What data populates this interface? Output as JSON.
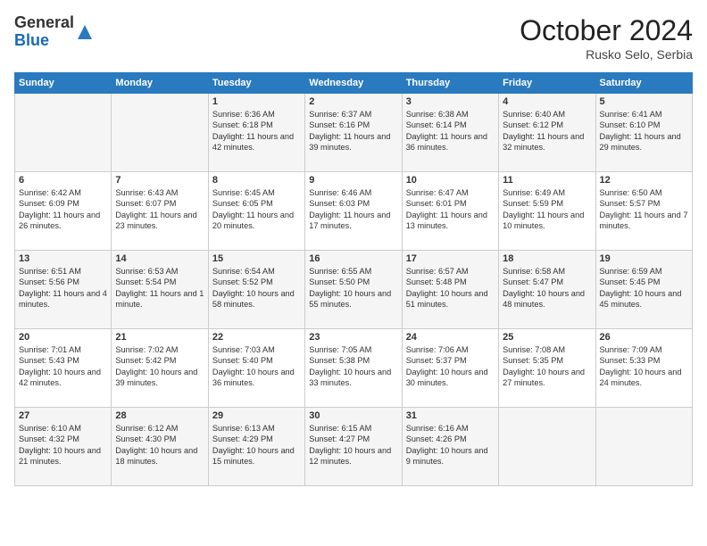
{
  "logo": {
    "general": "General",
    "blue": "Blue"
  },
  "header": {
    "month": "October 2024",
    "location": "Rusko Selo, Serbia"
  },
  "weekdays": [
    "Sunday",
    "Monday",
    "Tuesday",
    "Wednesday",
    "Thursday",
    "Friday",
    "Saturday"
  ],
  "weeks": [
    [
      {
        "day": "",
        "content": ""
      },
      {
        "day": "",
        "content": ""
      },
      {
        "day": "1",
        "content": "Sunrise: 6:36 AM\nSunset: 6:18 PM\nDaylight: 11 hours and 42 minutes."
      },
      {
        "day": "2",
        "content": "Sunrise: 6:37 AM\nSunset: 6:16 PM\nDaylight: 11 hours and 39 minutes."
      },
      {
        "day": "3",
        "content": "Sunrise: 6:38 AM\nSunset: 6:14 PM\nDaylight: 11 hours and 36 minutes."
      },
      {
        "day": "4",
        "content": "Sunrise: 6:40 AM\nSunset: 6:12 PM\nDaylight: 11 hours and 32 minutes."
      },
      {
        "day": "5",
        "content": "Sunrise: 6:41 AM\nSunset: 6:10 PM\nDaylight: 11 hours and 29 minutes."
      }
    ],
    [
      {
        "day": "6",
        "content": "Sunrise: 6:42 AM\nSunset: 6:09 PM\nDaylight: 11 hours and 26 minutes."
      },
      {
        "day": "7",
        "content": "Sunrise: 6:43 AM\nSunset: 6:07 PM\nDaylight: 11 hours and 23 minutes."
      },
      {
        "day": "8",
        "content": "Sunrise: 6:45 AM\nSunset: 6:05 PM\nDaylight: 11 hours and 20 minutes."
      },
      {
        "day": "9",
        "content": "Sunrise: 6:46 AM\nSunset: 6:03 PM\nDaylight: 11 hours and 17 minutes."
      },
      {
        "day": "10",
        "content": "Sunrise: 6:47 AM\nSunset: 6:01 PM\nDaylight: 11 hours and 13 minutes."
      },
      {
        "day": "11",
        "content": "Sunrise: 6:49 AM\nSunset: 5:59 PM\nDaylight: 11 hours and 10 minutes."
      },
      {
        "day": "12",
        "content": "Sunrise: 6:50 AM\nSunset: 5:57 PM\nDaylight: 11 hours and 7 minutes."
      }
    ],
    [
      {
        "day": "13",
        "content": "Sunrise: 6:51 AM\nSunset: 5:56 PM\nDaylight: 11 hours and 4 minutes."
      },
      {
        "day": "14",
        "content": "Sunrise: 6:53 AM\nSunset: 5:54 PM\nDaylight: 11 hours and 1 minute."
      },
      {
        "day": "15",
        "content": "Sunrise: 6:54 AM\nSunset: 5:52 PM\nDaylight: 10 hours and 58 minutes."
      },
      {
        "day": "16",
        "content": "Sunrise: 6:55 AM\nSunset: 5:50 PM\nDaylight: 10 hours and 55 minutes."
      },
      {
        "day": "17",
        "content": "Sunrise: 6:57 AM\nSunset: 5:48 PM\nDaylight: 10 hours and 51 minutes."
      },
      {
        "day": "18",
        "content": "Sunrise: 6:58 AM\nSunset: 5:47 PM\nDaylight: 10 hours and 48 minutes."
      },
      {
        "day": "19",
        "content": "Sunrise: 6:59 AM\nSunset: 5:45 PM\nDaylight: 10 hours and 45 minutes."
      }
    ],
    [
      {
        "day": "20",
        "content": "Sunrise: 7:01 AM\nSunset: 5:43 PM\nDaylight: 10 hours and 42 minutes."
      },
      {
        "day": "21",
        "content": "Sunrise: 7:02 AM\nSunset: 5:42 PM\nDaylight: 10 hours and 39 minutes."
      },
      {
        "day": "22",
        "content": "Sunrise: 7:03 AM\nSunset: 5:40 PM\nDaylight: 10 hours and 36 minutes."
      },
      {
        "day": "23",
        "content": "Sunrise: 7:05 AM\nSunset: 5:38 PM\nDaylight: 10 hours and 33 minutes."
      },
      {
        "day": "24",
        "content": "Sunrise: 7:06 AM\nSunset: 5:37 PM\nDaylight: 10 hours and 30 minutes."
      },
      {
        "day": "25",
        "content": "Sunrise: 7:08 AM\nSunset: 5:35 PM\nDaylight: 10 hours and 27 minutes."
      },
      {
        "day": "26",
        "content": "Sunrise: 7:09 AM\nSunset: 5:33 PM\nDaylight: 10 hours and 24 minutes."
      }
    ],
    [
      {
        "day": "27",
        "content": "Sunrise: 6:10 AM\nSunset: 4:32 PM\nDaylight: 10 hours and 21 minutes."
      },
      {
        "day": "28",
        "content": "Sunrise: 6:12 AM\nSunset: 4:30 PM\nDaylight: 10 hours and 18 minutes."
      },
      {
        "day": "29",
        "content": "Sunrise: 6:13 AM\nSunset: 4:29 PM\nDaylight: 10 hours and 15 minutes."
      },
      {
        "day": "30",
        "content": "Sunrise: 6:15 AM\nSunset: 4:27 PM\nDaylight: 10 hours and 12 minutes."
      },
      {
        "day": "31",
        "content": "Sunrise: 6:16 AM\nSunset: 4:26 PM\nDaylight: 10 hours and 9 minutes."
      },
      {
        "day": "",
        "content": ""
      },
      {
        "day": "",
        "content": ""
      }
    ]
  ]
}
